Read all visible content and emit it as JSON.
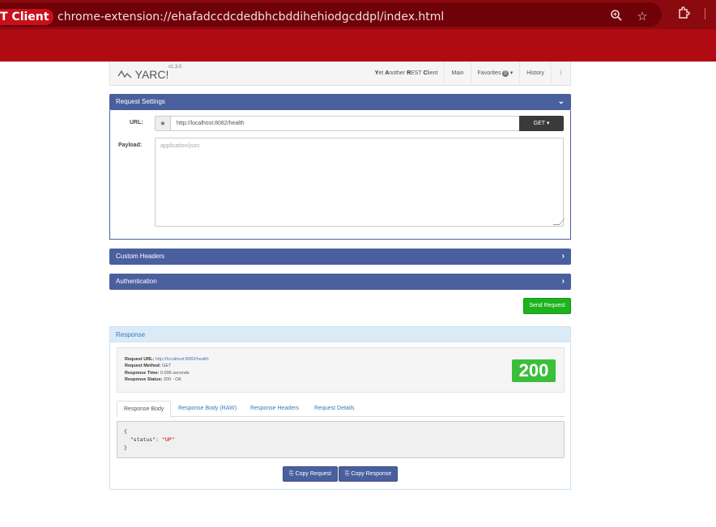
{
  "browser": {
    "tab_title": "T Client",
    "url": "chrome-extension://ehafadccdcdedbhcbddihehiodgcddpl/index.html",
    "icons": [
      "zoom-icon",
      "bookmark-star-icon",
      "extensions-icon"
    ]
  },
  "navbar": {
    "brand": "YARC!",
    "version": "v1.3.0",
    "tagline_parts": [
      "Y",
      "et ",
      "A",
      "nother ",
      "R",
      "EST ",
      "C",
      "lient"
    ],
    "links": {
      "main": "Main",
      "favorites": "Favorites",
      "favorites_count": "0",
      "history": "History",
      "more": "⋮"
    }
  },
  "request_settings": {
    "title": "Request Settings",
    "url_label": "URL:",
    "url_value": "http://localhost:8082/health",
    "method": "GET",
    "payload_label": "Payload:",
    "payload_placeholder": "application/json"
  },
  "panels": {
    "custom_headers": "Custom Headers",
    "authentication": "Authentication"
  },
  "send_button": "Send Request",
  "response": {
    "title": "Response",
    "summary": {
      "url_label": "Request URL:",
      "url_value": "http://localhost:8082/health",
      "method_label": "Request Method:",
      "method_value": "GET",
      "time_label": "Response Time:",
      "time_value": "0.006 seconds",
      "status_label": "Response Status:",
      "status_value": "200 - OK"
    },
    "status_code": "200",
    "tabs": [
      "Response Body",
      "Response Body (RAW)",
      "Response Headers",
      "Request Details"
    ],
    "body_lines": {
      "open": "{",
      "key": "  \"status\": ",
      "value": "\"UP\"",
      "close": "}"
    },
    "copy_request": "Copy Request",
    "copy_response": "Copy Response"
  },
  "colors": {
    "chrome": "#8b0a0f",
    "panel_header": "#4a5f9e",
    "send": "#1db31d",
    "status_ok": "#3bbf3b",
    "response_header": "#dbeaf7"
  }
}
